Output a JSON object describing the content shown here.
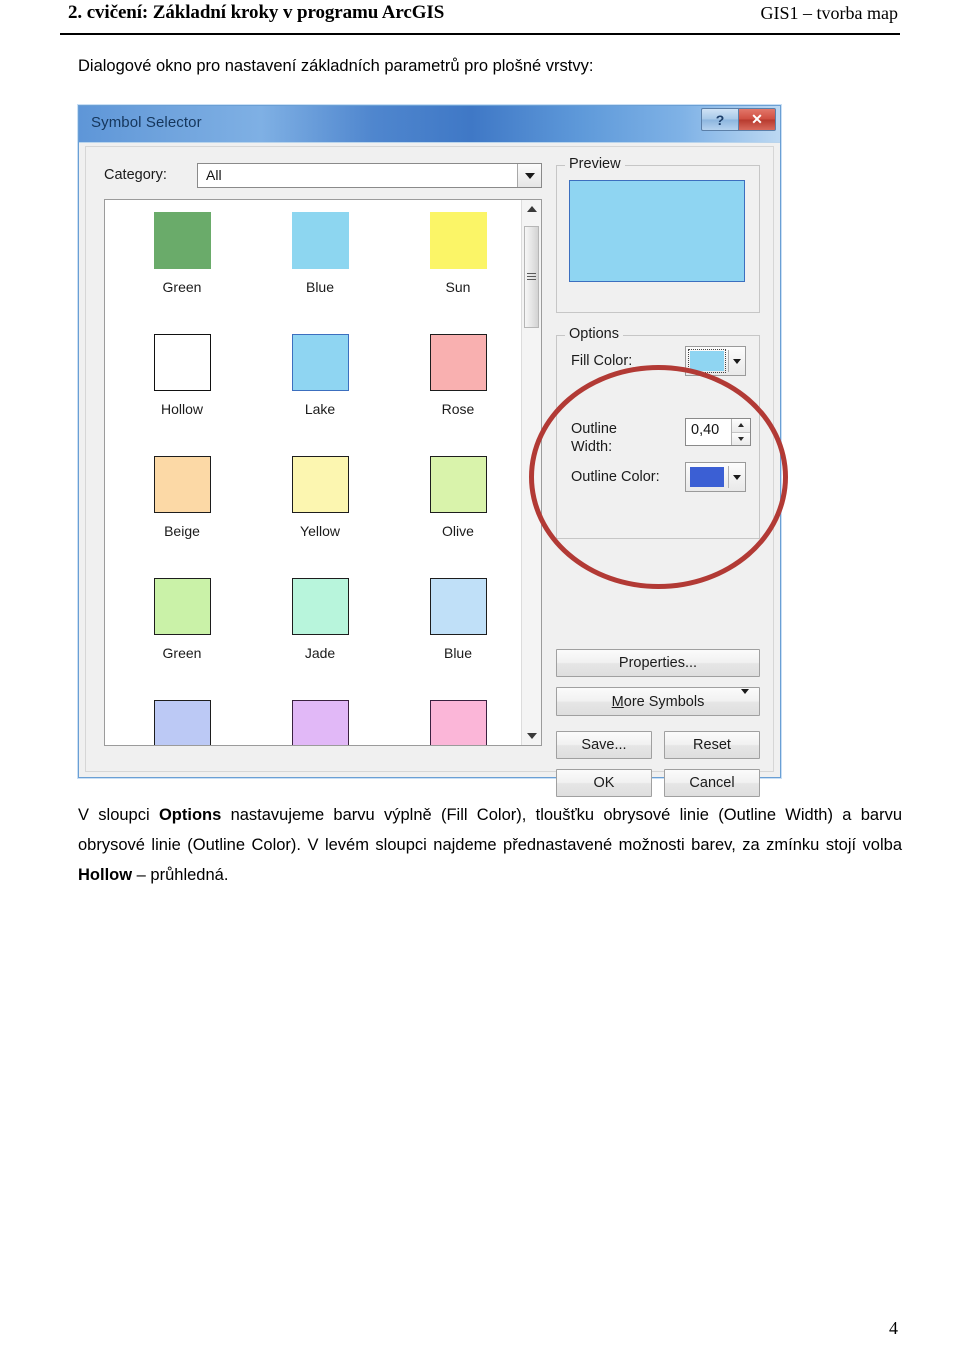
{
  "page": {
    "header_left": "2. cvičení: Základní kroky v programu ArcGIS",
    "header_right": "GIS1 – tvorba map",
    "intro": "Dialogové okno pro nastavení základních parametrů pro plošné vrstvy:",
    "page_number": "4",
    "body_part1": "V sloupci ",
    "body_bold1": "Options",
    "body_part2": " nastavujeme barvu výplně (Fill Color), tloušťku obrysové linie (Outline Width) a barvu obrysové linie (Outline Color). V levém sloupci najdeme přednastavené možnosti barev, za zmínku stojí volba ",
    "body_bold2": "Hollow",
    "body_part3": " – průhledná."
  },
  "dialog": {
    "title": "Symbol Selector",
    "help_button": "?",
    "close_button": "✕",
    "category": {
      "label": "Category:",
      "value": "All"
    },
    "symbols": [
      [
        {
          "label": "Green",
          "fill": "#6aab6a",
          "border": "none"
        },
        {
          "label": "Blue",
          "fill": "#8dd6f0",
          "border": "none"
        },
        {
          "label": "Sun",
          "fill": "#fbf567",
          "border": "none"
        }
      ],
      [
        {
          "label": "Hollow",
          "fill": "#ffffff",
          "border": "#111111"
        },
        {
          "label": "Lake",
          "fill": "#8fd5f2",
          "border": "#3c6fbf"
        },
        {
          "label": "Rose",
          "fill": "#f9b0b0",
          "border": "#1d1d1d"
        }
      ],
      [
        {
          "label": "Beige",
          "fill": "#fcd9a6",
          "border": "#1d1d1d"
        },
        {
          "label": "Yellow",
          "fill": "#fcf6b0",
          "border": "#1d1d1d"
        },
        {
          "label": "Olive",
          "fill": "#d9f3ab",
          "border": "#1d1d1d"
        }
      ],
      [
        {
          "label": "Green",
          "fill": "#caf2a8",
          "border": "#1d1d1d"
        },
        {
          "label": "Jade",
          "fill": "#b8f5dc",
          "border": "#1d1d1d"
        },
        {
          "label": "Blue",
          "fill": "#c0e0f8",
          "border": "#1d1d1d"
        }
      ],
      [
        {
          "label": "",
          "fill": "#bcc9f5",
          "border": "#1d1d1d"
        },
        {
          "label": "",
          "fill": "#e1b8f7",
          "border": "#3a2140"
        },
        {
          "label": "",
          "fill": "#fbb6d8",
          "border": "#3a2140"
        }
      ]
    ],
    "preview": {
      "title": "Preview",
      "fill": "#8fd5f2",
      "outline": "#3c6fbf"
    },
    "options": {
      "title": "Options",
      "fill_color_label": "Fill Color:",
      "fill_color_value": "#8fd5f2",
      "outline_width_label": "Outline Width:",
      "outline_width_value": "0,40",
      "outline_color_label": "Outline Color:",
      "outline_color_value": "#3b5fd4"
    },
    "buttons": {
      "properties": "Properties...",
      "more_symbols_underlined": "M",
      "more_symbols_rest": "ore Symbols",
      "save": "Save...",
      "reset": "Reset",
      "ok": "OK",
      "cancel": "Cancel"
    },
    "annotation_color": "#b23a35"
  }
}
